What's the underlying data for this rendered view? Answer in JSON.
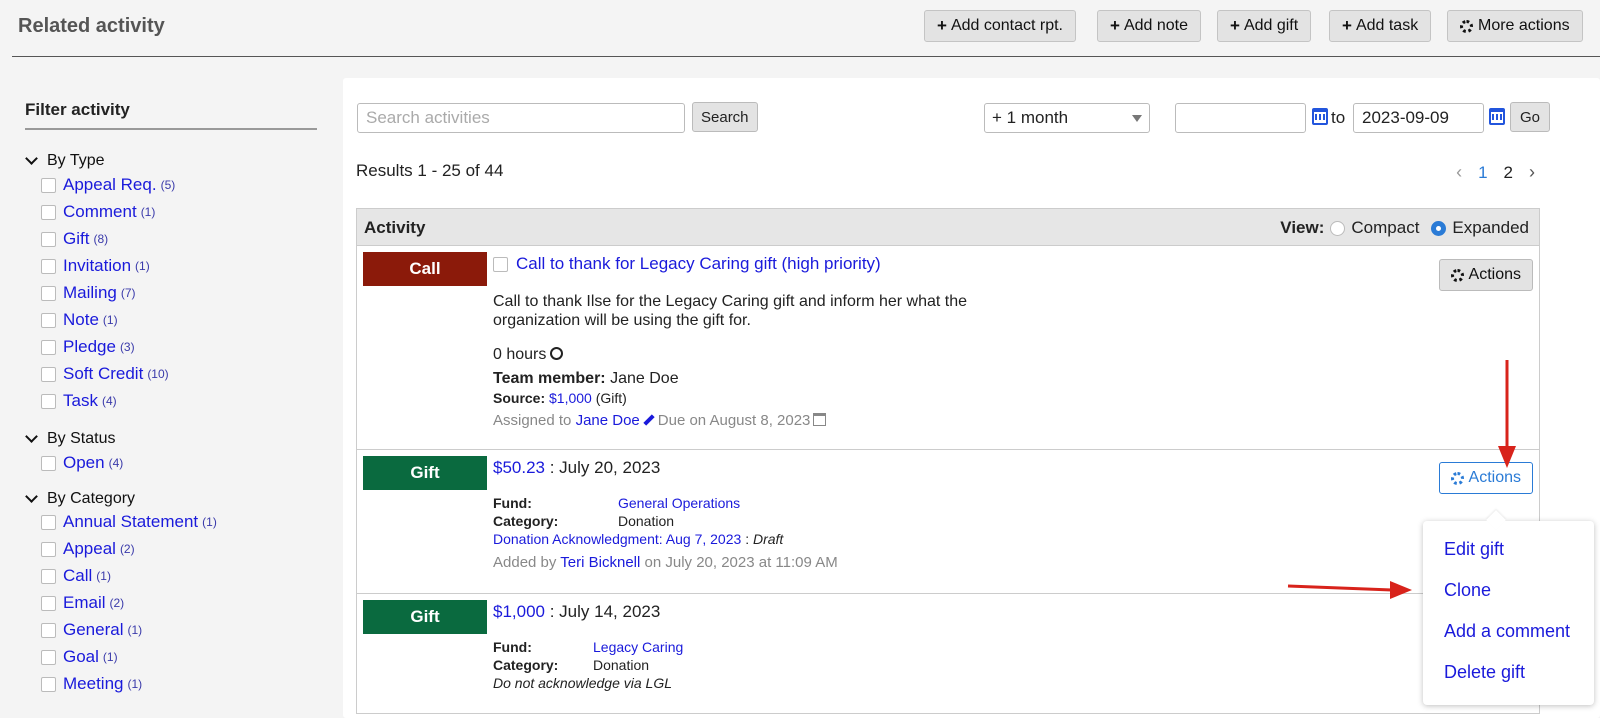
{
  "header": {
    "title": "Related activity",
    "buttons": [
      {
        "icon": "plus-icon",
        "label": "Add contact rpt."
      },
      {
        "icon": "plus-icon",
        "label": "Add note"
      },
      {
        "icon": "plus-icon",
        "label": "Add gift"
      },
      {
        "icon": "plus-icon",
        "label": "Add task"
      },
      {
        "icon": "gear-icon",
        "label": "More actions"
      }
    ]
  },
  "sidebar": {
    "title": "Filter activity",
    "groups": [
      {
        "label": "By Type",
        "items": [
          {
            "label": "Appeal Req.",
            "count": "(5)"
          },
          {
            "label": "Comment",
            "count": "(1)"
          },
          {
            "label": "Gift",
            "count": "(8)"
          },
          {
            "label": "Invitation",
            "count": "(1)"
          },
          {
            "label": "Mailing",
            "count": "(7)"
          },
          {
            "label": "Note",
            "count": "(1)"
          },
          {
            "label": "Pledge",
            "count": "(3)"
          },
          {
            "label": "Soft Credit",
            "count": "(10)"
          },
          {
            "label": "Task",
            "count": "(4)"
          }
        ]
      },
      {
        "label": "By Status",
        "items": [
          {
            "label": "Open",
            "count": "(4)"
          }
        ]
      },
      {
        "label": "By Category",
        "items": [
          {
            "label": "Annual Statement",
            "count": "(1)"
          },
          {
            "label": "Appeal",
            "count": "(2)"
          },
          {
            "label": "Call",
            "count": "(1)"
          },
          {
            "label": "Email",
            "count": "(2)"
          },
          {
            "label": "General",
            "count": "(1)"
          },
          {
            "label": "Goal",
            "count": "(1)"
          },
          {
            "label": "Meeting",
            "count": "(1)"
          }
        ]
      }
    ]
  },
  "toolbar": {
    "search_placeholder": "Search activities",
    "search_label": "Search",
    "range_value": "+ 1 month",
    "date_from": "",
    "to_label": "to",
    "date_to": "2023-09-09",
    "go_label": "Go"
  },
  "results": {
    "summary": "Results 1 - 25 of 44",
    "pages": [
      "1",
      "2"
    ],
    "prev": "‹",
    "next": "›"
  },
  "table": {
    "header": "Activity",
    "view_label": "View:",
    "view_compact": "Compact",
    "view_expanded": "Expanded",
    "rows": [
      {
        "badge": "Call",
        "title": "Call to thank for Legacy Caring gift (high priority)",
        "desc1": "Call to thank Ilse for the Legacy Caring gift and inform her what the",
        "desc2": "organization will be using the gift for.",
        "hours": "0 hours",
        "team_label": "Team member:",
        "team_value": "Jane Doe",
        "source_label": "Source:",
        "source_link": "$1,000",
        "source_suffix": "(Gift)",
        "assigned_prefix": "Assigned to",
        "assigned_user": "Jane Doe",
        "due": "Due on August 8, 2023",
        "actions": "Actions"
      },
      {
        "badge": "Gift",
        "amount": "$50.23",
        "date": ": July 20, 2023",
        "fund_label": "Fund:",
        "fund_value": "General Operations",
        "category_label": "Category:",
        "category_value": "Donation",
        "ack_link": "Donation Acknowledgment: Aug 7, 2023",
        "ack_sep": ":",
        "ack_status": "Draft",
        "added_prefix": "Added by",
        "added_user": "Teri Bicknell",
        "added_suffix": "on July 20, 2023 at 11:09 AM",
        "actions": "Actions"
      },
      {
        "badge": "Gift",
        "amount": "$1,000",
        "date": ": July 14, 2023",
        "fund_label": "Fund:",
        "fund_value": "Legacy Caring",
        "category_label": "Category:",
        "category_value": "Donation",
        "note": "Do not acknowledge via LGL"
      }
    ]
  },
  "dropdown": {
    "items": [
      "Edit gift",
      "Clone",
      "Add a comment",
      "Delete gift"
    ]
  },
  "colors": {
    "call_badge": "#8b1a0a",
    "gift_badge": "#0a6a3f",
    "link": "#1a1adb",
    "accent": "#2a7bd6",
    "annotation_arrow": "#d8231b"
  }
}
